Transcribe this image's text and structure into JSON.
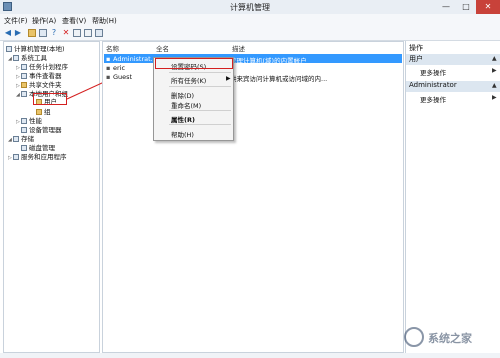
{
  "window": {
    "title": "计算机管理",
    "controls": [
      "—",
      "□",
      "✕"
    ]
  },
  "menubar": [
    "文件(F)",
    "操作(A)",
    "查看(V)",
    "帮助(H)"
  ],
  "toolbar_icons": [
    "back-arrow-icon",
    "forward-arrow-icon",
    "folder-icon",
    "list-icon",
    "help-icon",
    "delete-icon",
    "properties-icon",
    "export-icon",
    "view-icon"
  ],
  "tree": {
    "root": "计算机管理(本地)",
    "system_tools": "系统工具",
    "task_scheduler": "任务计划程序",
    "event_viewer": "事件查看器",
    "shared_folders": "共享文件夹",
    "local_users_groups": "本地用户和组",
    "users": "用户",
    "groups": "组",
    "performance": "性能",
    "device_manager": "设备管理器",
    "storage": "存储",
    "disk_management": "磁盘管理",
    "services_apps": "服务和应用程序"
  },
  "list": {
    "headers": [
      "名称",
      "全名",
      "描述"
    ],
    "rows": [
      {
        "name": "Administrat...",
        "fullname": "",
        "desc": "管理计算机(域)的内置帐户"
      },
      {
        "name": "eric",
        "fullname": "",
        "desc": ""
      },
      {
        "name": "Guest",
        "fullname": "",
        "desc": "供来宾访问计算机或访问域的内..."
      }
    ]
  },
  "context_menu": {
    "set_password": "设置密码(S)...",
    "all_tasks": "所有任务(K)",
    "delete": "删除(D)",
    "rename": "重命名(M)",
    "properties": "属性(R)",
    "help": "帮助(H)"
  },
  "actions_pane": {
    "title": "操作",
    "section1": "用户",
    "more1": "更多操作",
    "section2": "Administrator",
    "more2": "更多操作"
  },
  "watermark": "系统之家",
  "colors": {
    "selection": "#3399ff",
    "highlight": "#d42020",
    "section_bg": "#dce6f0"
  }
}
